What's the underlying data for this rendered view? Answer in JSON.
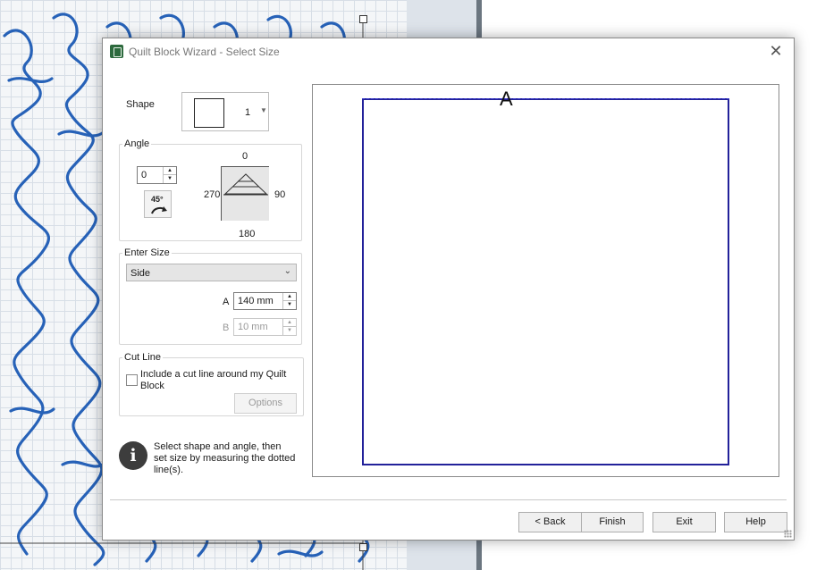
{
  "dialog": {
    "title": "Quilt Block Wizard - Select Size",
    "close_symbol": "✕"
  },
  "shape": {
    "label": "Shape",
    "value": "1",
    "arrow": "▼"
  },
  "angle": {
    "group_label": "Angle",
    "value": "0",
    "rotate_label": "45°",
    "dial": {
      "top": "0",
      "right": "90",
      "bottom": "180",
      "left": "270"
    }
  },
  "enter_size": {
    "group_label": "Enter Size",
    "mode": "Side",
    "chevron": "⌄",
    "a_label": "A",
    "a_value": "140 mm",
    "b_label": "B",
    "b_value": "10 mm"
  },
  "cut_line": {
    "group_label": "Cut Line",
    "checkbox_label": "Include a cut line around my Quilt Block",
    "checked": false,
    "options_label": "Options"
  },
  "info": {
    "icon": "i",
    "text": "Select shape and angle, then set size by measuring the dotted line(s)."
  },
  "preview": {
    "label": "A",
    "stroke_color": "#22219a"
  },
  "footer": {
    "back_label": "< Back",
    "finish_label": "Finish",
    "exit_label": "Exit",
    "help_label": "Help"
  },
  "spin": {
    "up": "▲",
    "down": "▼"
  },
  "colors": {
    "stipple": "#1d5bb5",
    "title_icon": "#2d6a3e"
  }
}
